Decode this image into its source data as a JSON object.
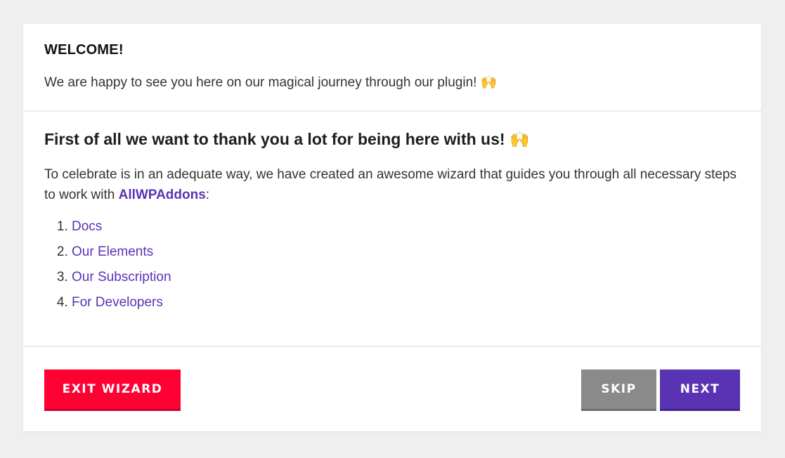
{
  "welcome": {
    "title": "WELCOME!",
    "text": "We are happy to see you here on our magical journey through our plugin!",
    "emoji": "🙌"
  },
  "body": {
    "heading": "First of all we want to thank you a lot for being here with us!",
    "heading_emoji": "🙌",
    "intro_before": "To celebrate is in an adequate way, we have created an awesome wizard that guides you through all necessary steps to work with ",
    "brand": "AllWPAddons",
    "intro_after": ":",
    "steps": [
      {
        "label": "Docs"
      },
      {
        "label": "Our Elements"
      },
      {
        "label": "Our Subscription"
      },
      {
        "label": "For Developers"
      }
    ]
  },
  "footer": {
    "exit_label": "EXIT WIZARD",
    "skip_label": "SKIP",
    "next_label": "NEXT"
  },
  "colors": {
    "accent": "#5a33b4",
    "exit": "#ff0033",
    "skip": "#8a8a8a",
    "background": "#efefef"
  }
}
